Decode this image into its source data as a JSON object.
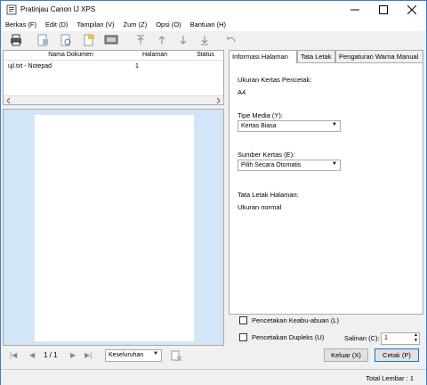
{
  "window": {
    "title": "Pratinjau Canon IJ XPS"
  },
  "menu": [
    "Berkas (F)",
    "Edit (D)",
    "Tampilan (V)",
    "Zum (Z)",
    "Opsi (O)",
    "Bantuan (H)"
  ],
  "doclist": {
    "headers": {
      "name": "Nama Dokumen",
      "pages": "Halaman",
      "status": "Status"
    },
    "rows": [
      {
        "name": "ujl.txt - Notepad",
        "pages": "1",
        "status": ""
      }
    ]
  },
  "nav": {
    "page_indicator": "1 / 1",
    "zoom_value": "Keseluruhan"
  },
  "tabs": [
    "Informasi Halaman",
    "Tata Letak",
    "Pengaturan Warna Manual"
  ],
  "info": {
    "paper_size_label": "Ukuran Kertas Pencetak:",
    "paper_size_value": "A4",
    "media_label": "Tipe Media (Y):",
    "media_value": "Kertas Biasa",
    "source_label": "Sumber Kertas (E):",
    "source_value": "Pilih Secara Otomatis",
    "layout_label": "Tata Letak Halaman:",
    "layout_value": "Ukuran normal"
  },
  "options": {
    "grayscale": "Pencetakan Keabu-abuan (L)",
    "duplex": "Pencetakan Dupleks (U)",
    "copies_label": "Salinan (C):",
    "copies_value": "1"
  },
  "buttons": {
    "exit": "Keluar (X)",
    "print": "Cetak (P)"
  },
  "status": {
    "total": "Total Lembar : 1"
  }
}
